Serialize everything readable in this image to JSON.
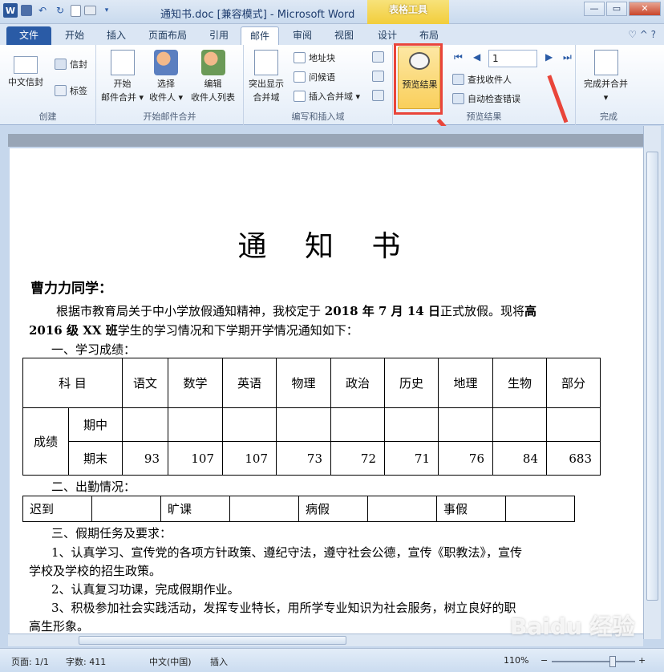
{
  "window": {
    "title": "通知书.doc [兼容模式] - Microsoft Word",
    "context_tab_group": "表格工具",
    "qat": {
      "logo": "W",
      "undo": "↶",
      "redo": "↻"
    },
    "buttons": {
      "minimize": "—",
      "restore": "▭",
      "close": "✕"
    }
  },
  "tabs": [
    {
      "label": "文件"
    },
    {
      "label": "开始"
    },
    {
      "label": "插入"
    },
    {
      "label": "页面布局"
    },
    {
      "label": "引用"
    },
    {
      "label": "邮件"
    },
    {
      "label": "审阅"
    },
    {
      "label": "视图"
    },
    {
      "label": "设计"
    },
    {
      "label": "布局"
    }
  ],
  "tabs_right": {
    "help": "♡ ^ ?"
  },
  "ribbon": {
    "create": {
      "title": "创建",
      "chinese_envelope": "中文信封",
      "envelope": "信封",
      "label": "标签"
    },
    "start_merge": {
      "title": "开始邮件合并",
      "start_line1": "开始",
      "start_line2": "邮件合并 ▾",
      "select_line1": "选择",
      "select_line2": "收件人 ▾",
      "edit_line1": "编辑",
      "edit_line2": "收件人列表"
    },
    "write_insert": {
      "title": "编写和插入域",
      "highlight_line1": "突出显示",
      "highlight_line2": "合并域",
      "address_block": "地址块",
      "greeting": "问候语",
      "insert_field": "插入合并域 ▾"
    },
    "preview": {
      "title": "预览结果",
      "preview_btn": "预览结果",
      "record": "1",
      "find_recipient": "查找收件人",
      "auto_check": "自动检查错误"
    },
    "finish": {
      "title": "完成",
      "finish_merge": "完成并合并",
      "dropdown": "▾"
    }
  },
  "document": {
    "heading": "通 知 书",
    "salutation": "曹力力同学：",
    "intro_line1_a": "根据市教育局关于中小学放假通知精神，我校定于 ",
    "intro_date": "2018 年 7 月 14 日",
    "intro_line1_b": "正式放假。现将",
    "intro_class_a": "高",
    "intro_class_b": "2016 级 XX 班",
    "intro_line2": "学生的学习情况和下学期开学情况通知如下：",
    "section1": "一、学习成绩：",
    "score_table": {
      "subject_header": "科 目",
      "subjects": [
        "语文",
        "数学",
        "英语",
        "物理",
        "政治",
        "历史",
        "地理",
        "生物",
        "部分"
      ],
      "score_label": "成绩",
      "midterm_label": "期中",
      "final_label": "期末",
      "midterm": [
        "",
        "",
        "",
        "",
        "",
        "",
        "",
        "",
        ""
      ],
      "final": [
        "93",
        "107",
        "107",
        "73",
        "72",
        "71",
        "76",
        "84",
        "683"
      ]
    },
    "section2": "二、出勤情况：",
    "attendance": [
      "迟到",
      "",
      "旷课",
      "",
      "病假",
      "",
      "事假",
      ""
    ],
    "section3": "三、假期任务及要求：",
    "task1_a": "1、认真学习、宣传党的各项方针政策、遵纪守法，遵守社会公德，宣传《职教法》，宣传",
    "task1_b": "学校及学校的招生政策。",
    "task2": "2、认真复习功课，完成假期作业。",
    "task3_a": "3、积极参加社会实践活动，发挥专业特长，用所学专业知识为社会服务，树立良好的职",
    "task3_b": "高生形象。",
    "para_mark": "↵"
  },
  "status": {
    "page": "页面: 1/1",
    "words": "字数: 411",
    "language": "中文(中国)",
    "mode": "插入",
    "zoom": "110%",
    "zoom_minus": "−",
    "zoom_plus": "+"
  },
  "watermark": "Baidu 经验",
  "colors": {
    "accent": "#2a5ba6",
    "highlight": "#f9cf5b",
    "annotation": "#e9453a"
  }
}
